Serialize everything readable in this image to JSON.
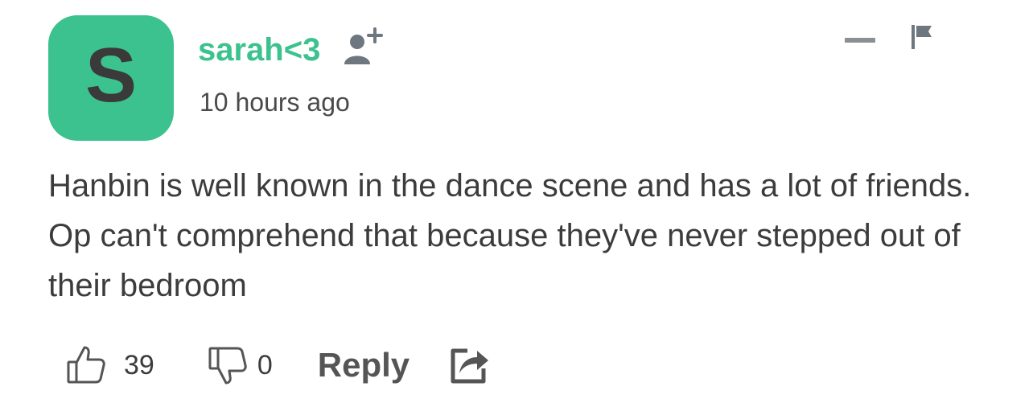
{
  "comment": {
    "avatar_letter": "S",
    "avatar_color": "#3cc28e",
    "username": "sarah<3",
    "timestamp": "10 hours ago",
    "body": "Hanbin is well known in the dance scene and has a lot of friends. Op can't comprehend that because they've never stepped out of their bedroom",
    "icons": {
      "follow": "add-user-icon",
      "collapse": "minus-icon",
      "report": "flag-icon",
      "upvote": "thumbs-up-icon",
      "downvote": "thumbs-down-icon",
      "share": "share-icon"
    }
  },
  "actions": {
    "upvote_count": "39",
    "downvote_count": "0",
    "reply_label": "Reply"
  }
}
